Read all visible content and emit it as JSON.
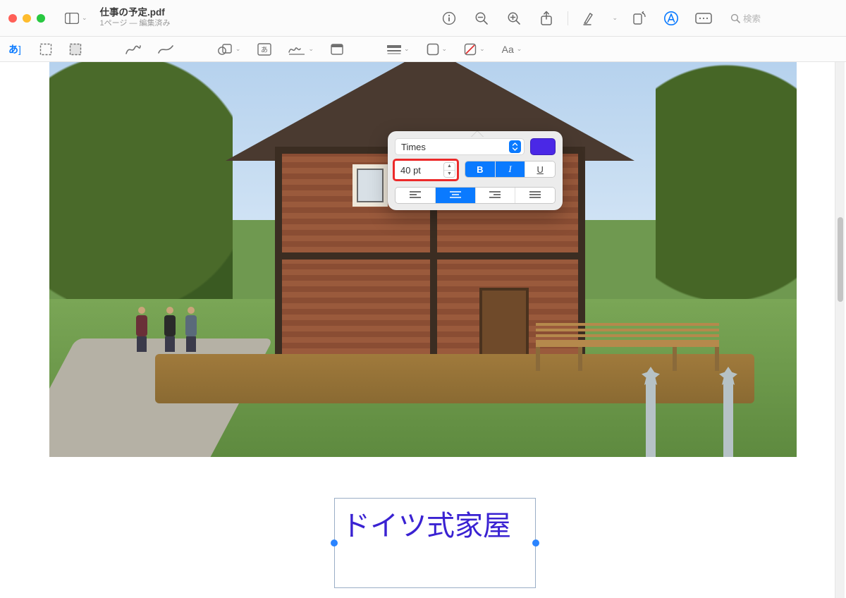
{
  "window": {
    "title": "仕事の予定.pdf",
    "subtitle": "1ページ — 編集済み"
  },
  "search": {
    "placeholder": "検索"
  },
  "textbox": {
    "content": "ドイツ式家屋"
  },
  "popover": {
    "font_name": "Times",
    "font_size": "40 pt",
    "style": {
      "bold_label": "B",
      "italic_label": "I",
      "underline_label": "U",
      "bold": true,
      "italic": true,
      "underline": false
    },
    "align_selected": "center",
    "color_swatch": "#4a28e6"
  },
  "icons": {
    "sidebar": "sidebar",
    "info": "info",
    "zoom_out": "zoom-out",
    "zoom_in": "zoom-in",
    "share": "share",
    "highlight": "highlight",
    "rotate": "rotate",
    "markup": "markup",
    "form": "form",
    "magnifier": "magnifier"
  }
}
